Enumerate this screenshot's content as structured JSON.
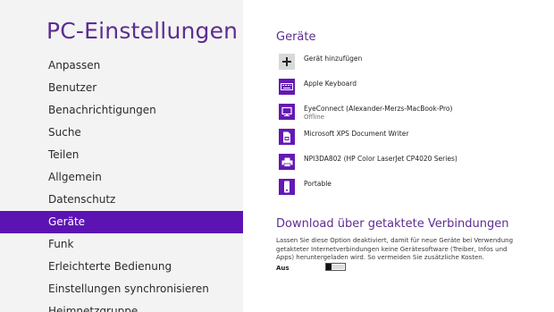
{
  "app": {
    "title": "PC-Einstellungen"
  },
  "sidebar": {
    "items": [
      {
        "label": "Anpassen"
      },
      {
        "label": "Benutzer"
      },
      {
        "label": "Benachrichtigungen"
      },
      {
        "label": "Suche"
      },
      {
        "label": "Teilen"
      },
      {
        "label": "Allgemein"
      },
      {
        "label": "Datenschutz"
      },
      {
        "label": "Geräte",
        "selected": true
      },
      {
        "label": "Funk"
      },
      {
        "label": "Erleichterte Bedienung"
      },
      {
        "label": "Einstellungen synchronisieren"
      },
      {
        "label": "Heimnetzgruppe"
      }
    ]
  },
  "devices": {
    "title": "Geräte",
    "add_label": "Gerät hinzufügen",
    "items": [
      {
        "name": "Apple Keyboard",
        "icon": "keyboard-icon"
      },
      {
        "name": "EyeConnect (Alexander-Merzs-MacBook-Pro)",
        "status": "Offline",
        "icon": "monitor-icon"
      },
      {
        "name": "Microsoft XPS Document Writer",
        "icon": "document-printer-icon"
      },
      {
        "name": "NPI3DA802 (HP Color LaserJet CP4020 Series)",
        "icon": "printer-icon"
      },
      {
        "name": "Portable",
        "icon": "portable-drive-icon"
      }
    ]
  },
  "metered": {
    "title": "Download über getaktete Verbindungen",
    "description": "Lassen Sie diese Option deaktiviert, damit für neue Geräte bei Verwendung getakteter Internetverbindungen keine Gerätesoftware (Treiber, Infos und Apps) heruntergeladen wird. So vermeiden Sie zusätzliche Kosten.",
    "toggle_label": "Aus",
    "toggle_on": false
  },
  "colors": {
    "accent": "#5c13b4",
    "title": "#5c2d91",
    "sidebar_bg": "#f3f3f3"
  }
}
